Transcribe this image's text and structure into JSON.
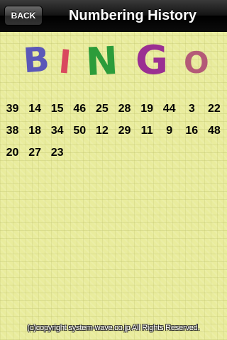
{
  "nav": {
    "back_label": "BACK",
    "title": "Numbering History"
  },
  "logo": {
    "letters": [
      {
        "char": "B",
        "color": "#5a57b8"
      },
      {
        "char": "I",
        "color": "#d9485e"
      },
      {
        "char": "N",
        "color": "#2c9c3a"
      },
      {
        "char": "G",
        "color": "#9a2f92"
      },
      {
        "char": "O",
        "color": "#b45a77"
      }
    ]
  },
  "numbers": [
    "39",
    "14",
    "15",
    "46",
    "25",
    "28",
    "19",
    "44",
    "3",
    "22",
    "38",
    "18",
    "34",
    "50",
    "12",
    "29",
    "11",
    "9",
    "16",
    "48",
    "20",
    "27",
    "23"
  ],
  "footer": {
    "copyright": "(c)copyright system-wave.co.jp All Rights Reserved."
  }
}
